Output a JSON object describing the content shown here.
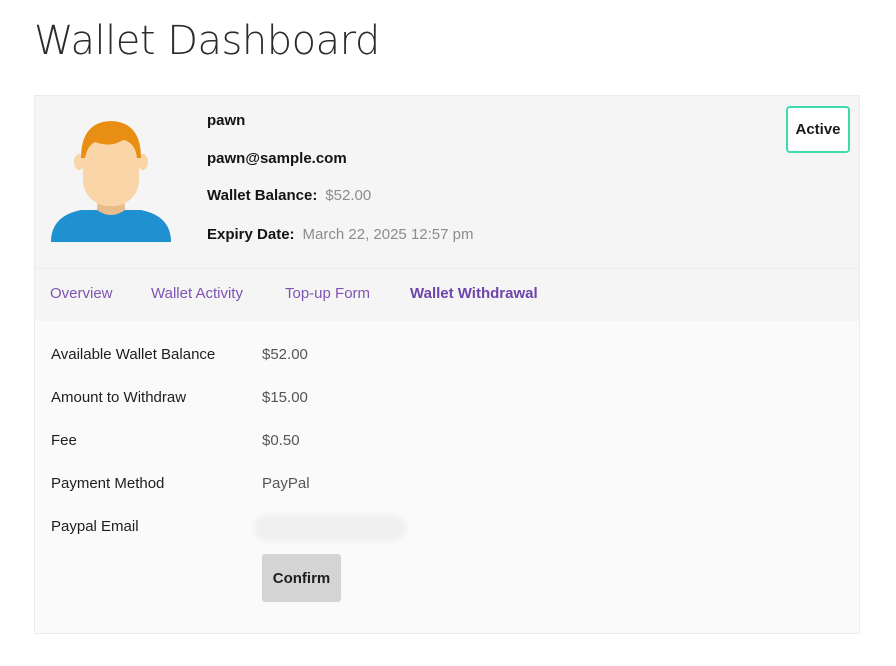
{
  "page": {
    "title": "Wallet Dashboard"
  },
  "profile": {
    "username": "pawn",
    "email": "pawn@sample.com",
    "wallet_balance_label": "Wallet Balance:",
    "wallet_balance_value": "$52.00",
    "expiry_label": "Expiry Date:",
    "expiry_value": "March 22, 2025 12:57 pm",
    "status": "Active"
  },
  "tabs": [
    {
      "label": "Overview",
      "active": false
    },
    {
      "label": "Wallet Activity",
      "active": false
    },
    {
      "label": "Top-up Form",
      "active": false
    },
    {
      "label": "Wallet Withdrawal",
      "active": true
    }
  ],
  "withdrawal": {
    "fields": [
      {
        "label": "Available Wallet Balance",
        "value": "$52.00"
      },
      {
        "label": "Amount to Withdraw",
        "value": "$15.00"
      },
      {
        "label": "Fee",
        "value": "$0.50"
      },
      {
        "label": "Payment Method",
        "value": "PayPal"
      },
      {
        "label": "Paypal Email",
        "value": ""
      }
    ],
    "confirm_label": "Confirm"
  },
  "colors": {
    "accent": "#7f54b3",
    "status_border": "#3fd9b0",
    "avatar_hair": "#e88e12",
    "avatar_skin": "#f9d5a7",
    "avatar_shirt": "#1f91d0"
  }
}
